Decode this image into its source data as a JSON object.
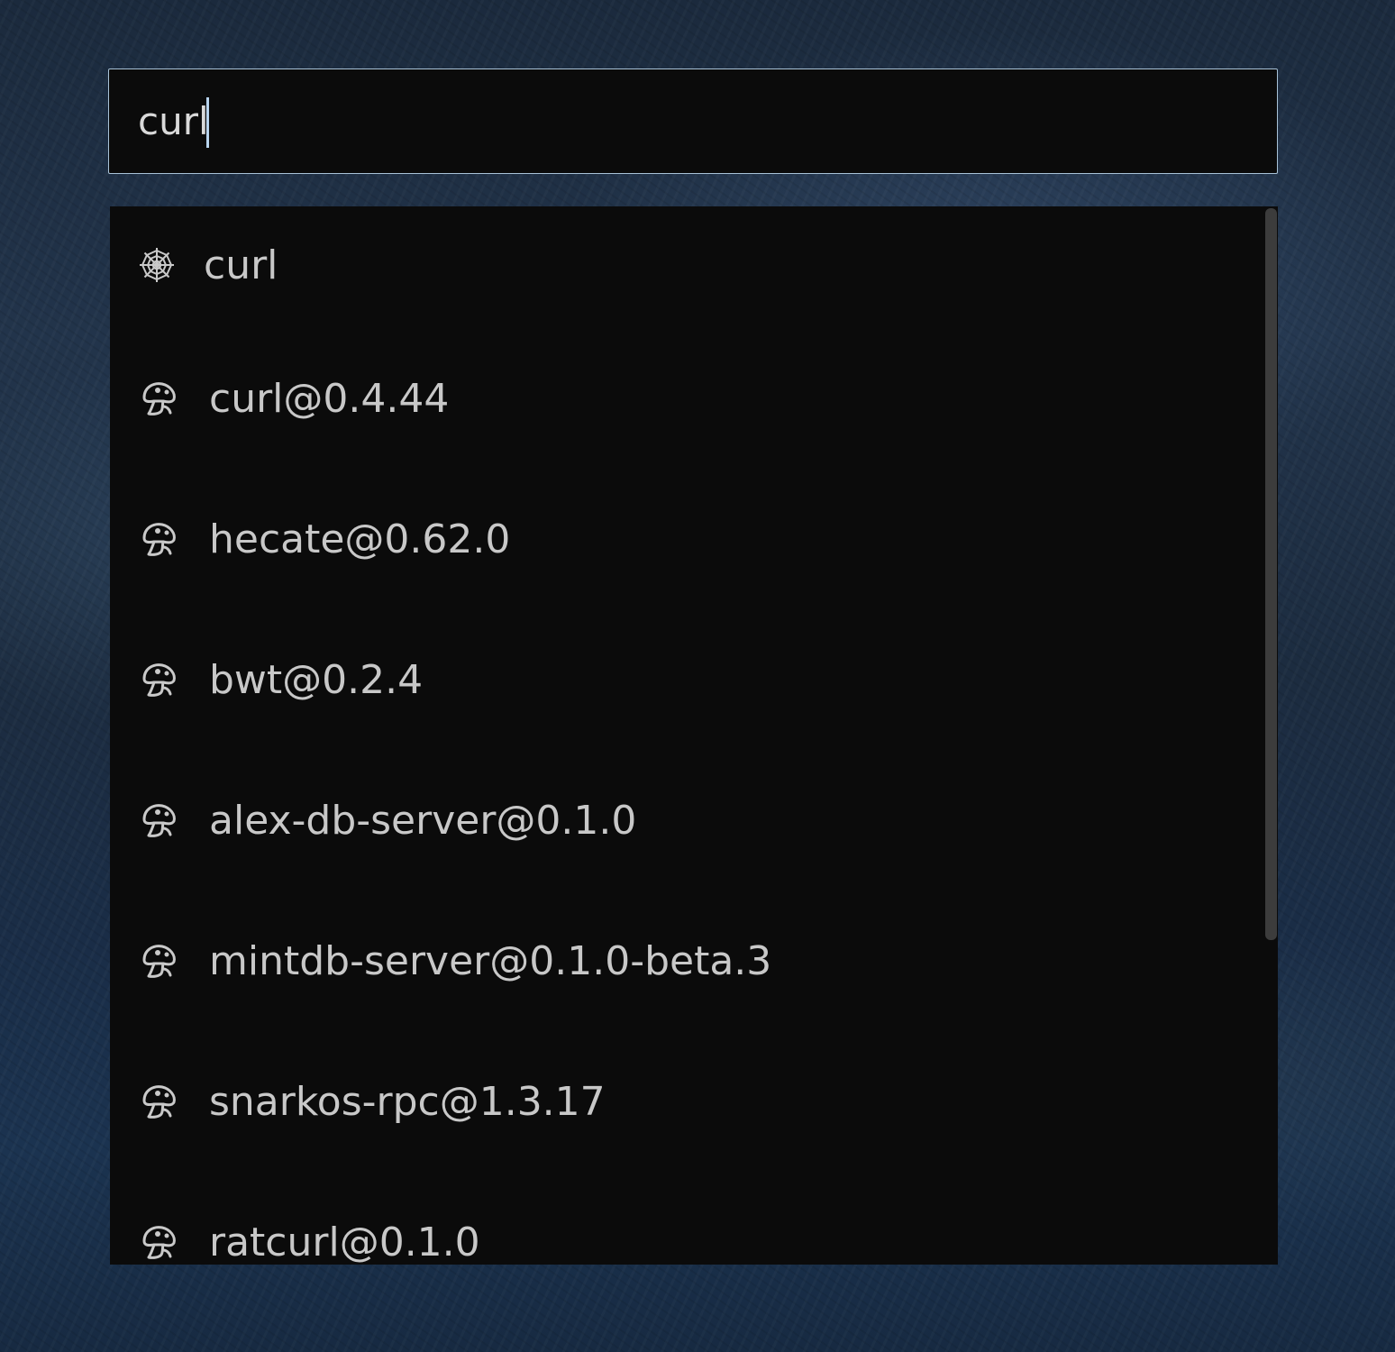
{
  "search": {
    "value": "curl"
  },
  "results": [
    {
      "icon": "spider-web-icon",
      "label": "curl"
    },
    {
      "icon": "mushroom-icon",
      "label": "curl@0.4.44"
    },
    {
      "icon": "mushroom-icon",
      "label": "hecate@0.62.0"
    },
    {
      "icon": "mushroom-icon",
      "label": "bwt@0.2.4"
    },
    {
      "icon": "mushroom-icon",
      "label": "alex-db-server@0.1.0"
    },
    {
      "icon": "mushroom-icon",
      "label": "mintdb-server@0.1.0-beta.3"
    },
    {
      "icon": "mushroom-icon",
      "label": "snarkos-rpc@1.3.17"
    },
    {
      "icon": "mushroom-icon",
      "label": "ratcurl@0.1.0"
    }
  ],
  "colors": {
    "panel_bg": "#0b0b0b",
    "text": "#c8c8c8",
    "input_border": "#a9c3d8",
    "caret": "#b8d4ee",
    "scrollbar_thumb": "#3c3c3c"
  }
}
